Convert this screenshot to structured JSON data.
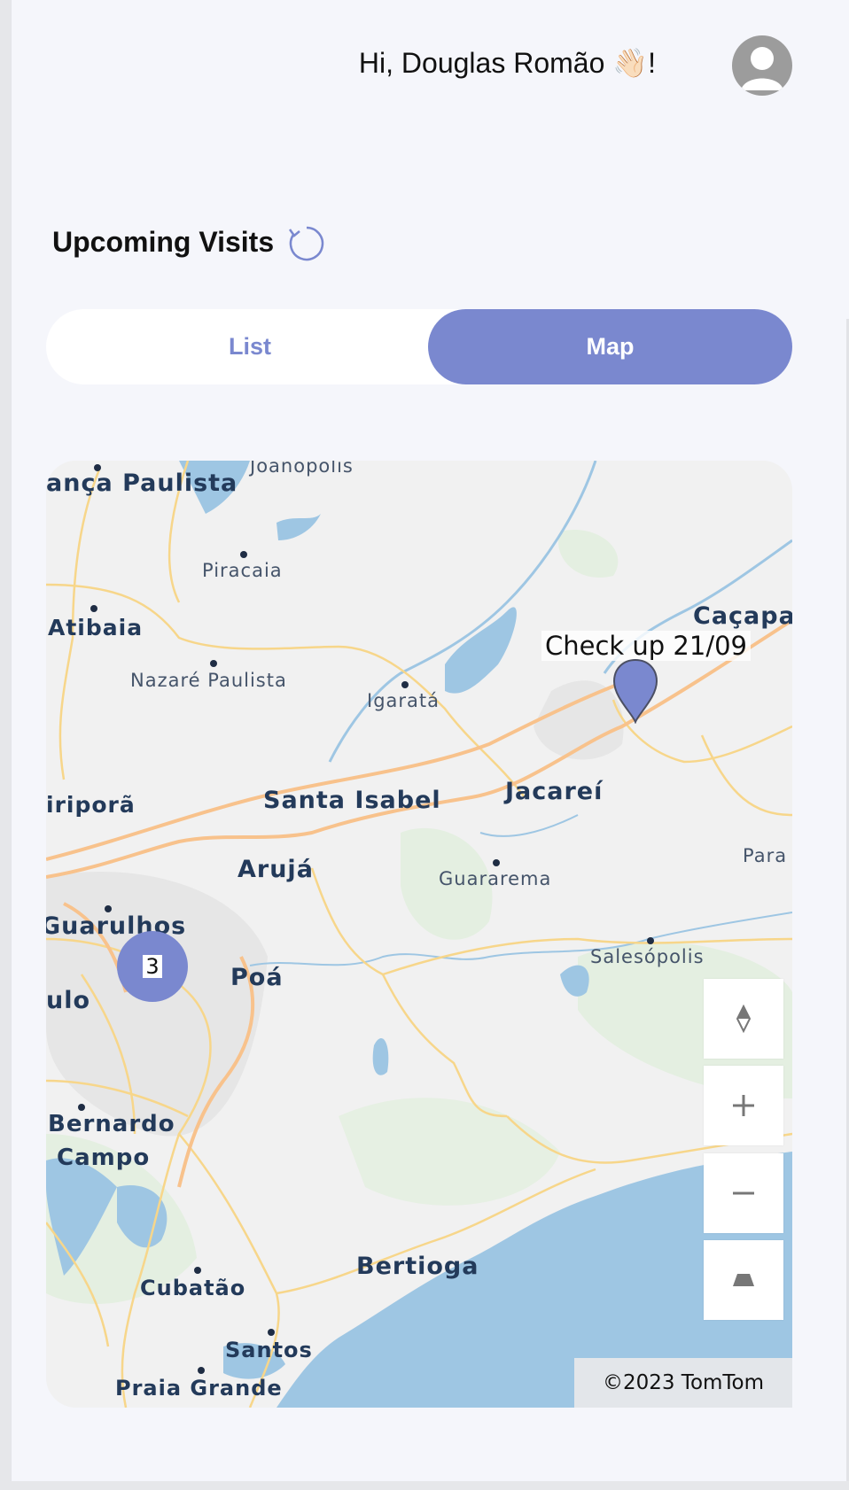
{
  "header": {
    "greeting": "Hi, Douglas Romão 👋🏻!"
  },
  "visits": {
    "title": "Upcoming Visits"
  },
  "view_toggle": {
    "list_label": "List",
    "map_label": "Map",
    "selected": "Map"
  },
  "map": {
    "cities": {
      "braganca": "ança Paulista",
      "atibaia": "Atibaia",
      "santa_isabel": "Santa Isabel",
      "jacarei": "Jacareí",
      "aruja": "Arujá",
      "guarulhos": "Guarulhos",
      "poa": "Poá",
      "sao_paulo": "ulo",
      "sbc1": "Bernardo",
      "sbc2": "Campo",
      "bertioga": "Bertioga",
      "cacapava": "Caçapa",
      "mairipora": "iriporã"
    },
    "towns": {
      "joanopolis": "Joanópolis",
      "piracaia": "Piracaia",
      "nazare": "Nazaré Paulista",
      "igarata": "Igaratá",
      "guararema": "Guararema",
      "para": "Para",
      "salesopolis": "Salesópolis",
      "cubatao": "Cubatão",
      "santos": "Santos",
      "praia_grande": "Praia Grande"
    },
    "marker_label": "Check up 21/09",
    "cluster_count": "3",
    "attribution": "©2023 TomTom"
  },
  "icons": {
    "refresh": "refresh-icon",
    "compass": "compass-icon",
    "zoom_in": "plus-icon",
    "zoom_out": "minus-icon",
    "pitch": "pitch-icon",
    "avatar": "user-avatar-icon"
  },
  "colors": {
    "accent": "#7a88cf",
    "background": "#f5f6fb",
    "water": "#9ec6e3"
  }
}
